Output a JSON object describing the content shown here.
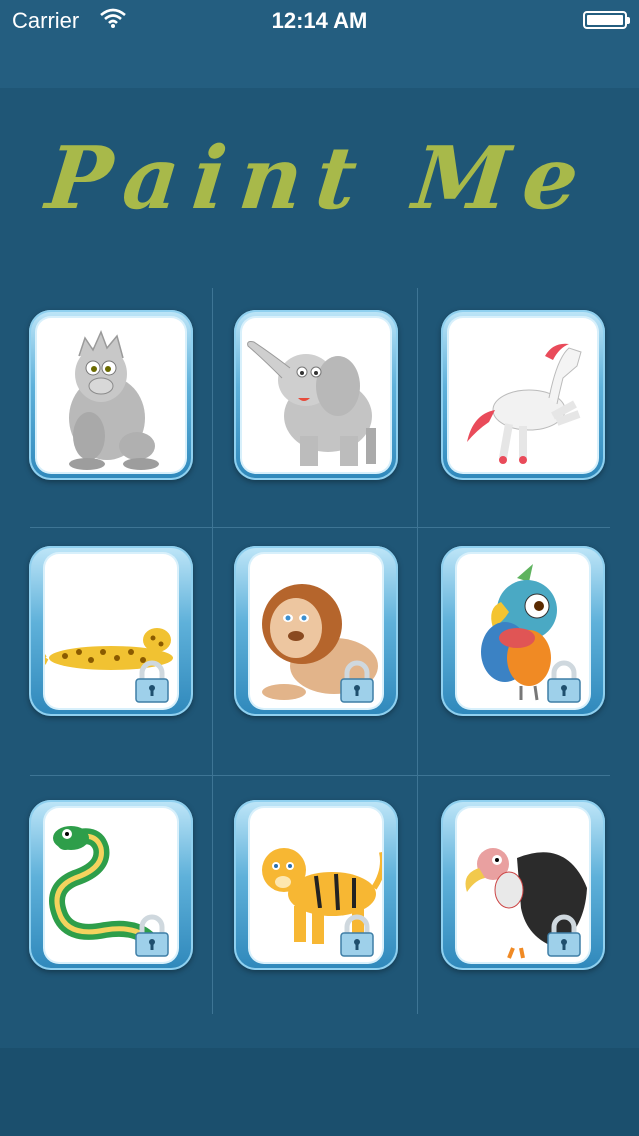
{
  "status_bar": {
    "carrier": "Carrier",
    "time": "12:14 AM"
  },
  "title": "Paint Me",
  "colors": {
    "background": "#1f5676",
    "title": "#a8b94a",
    "tile_frame": "#5fb1da"
  },
  "tiles": [
    {
      "animal": "gorilla",
      "locked": false
    },
    {
      "animal": "elephant",
      "locked": false
    },
    {
      "animal": "horse",
      "locked": false
    },
    {
      "animal": "leopard",
      "locked": true
    },
    {
      "animal": "lion",
      "locked": true
    },
    {
      "animal": "parrot",
      "locked": true
    },
    {
      "animal": "snake",
      "locked": true
    },
    {
      "animal": "tiger",
      "locked": true
    },
    {
      "animal": "vulture",
      "locked": true
    }
  ],
  "icons": {
    "wifi": "wifi-icon",
    "battery": "battery-icon",
    "lock": "lock-icon"
  }
}
